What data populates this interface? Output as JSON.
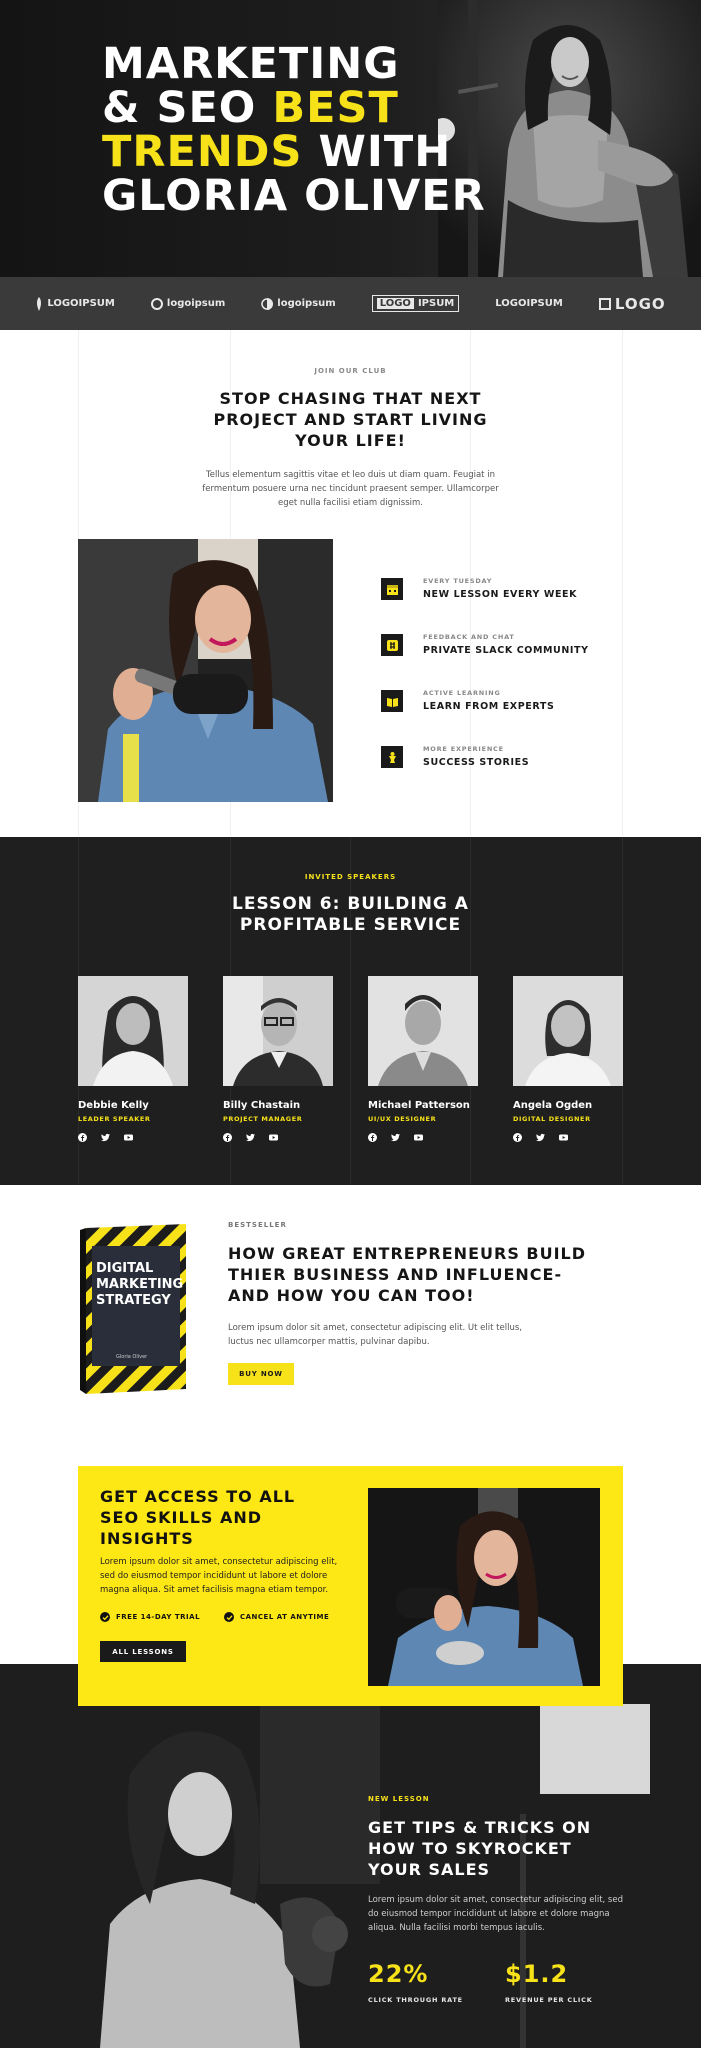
{
  "hero": {
    "title_line1": "MARKETING",
    "title_line2_a": "& SEO ",
    "title_line2_b": "BEST",
    "title_line3_a": "TRENDS",
    "title_line3_b": " WITH",
    "title_line4": "GLORIA OLIVER",
    "accent": "#f7e21a"
  },
  "logos": [
    "LOGOIPSUM",
    "logoipsum",
    "logoipsum",
    "IPSUM",
    "LOGOIPSUM",
    "LOGO"
  ],
  "club": {
    "eyebrow": "JOIN OUR CLUB",
    "title": "STOP CHASING THAT NEXT PROJECT AND START LIVING YOUR LIFE!",
    "text": "Tellus elementum sagittis vitae et leo duis ut diam quam. Feugiat in fermentum posuere urna nec tincidunt praesent semper. Ullamcorper eget nulla facilisi etiam dignissim.",
    "features": [
      {
        "small": "EVERY TUESDAY",
        "big": "NEW LESSON EVERY WEEK",
        "icon": "calendar-icon"
      },
      {
        "small": "FEEDBACK AND CHAT",
        "big": "PRIVATE SLACK COMMUNITY",
        "icon": "slack-icon"
      },
      {
        "small": "ACTIVE LEARNING",
        "big": "LEARN FROM EXPERTS",
        "icon": "book-icon"
      },
      {
        "small": "MORE EXPERIENCE",
        "big": "SUCCESS STORIES",
        "icon": "trophy-icon"
      }
    ]
  },
  "speakers": {
    "eyebrow": "INVITED SPEAKERS",
    "title": "LESSON 6: BUILDING A PROFITABLE SERVICE",
    "items": [
      {
        "name": "Debbie Kelly",
        "role": "LEADER SPEAKER"
      },
      {
        "name": "Billy Chastain",
        "role": "PROJECT MANAGER"
      },
      {
        "name": "Michael Patterson",
        "role": "UI/UX DESIGNER"
      },
      {
        "name": "Angela Ogden",
        "role": "DIGITAL DESIGNER"
      }
    ]
  },
  "bestseller": {
    "eyebrow": "BESTSELLER",
    "title": "HOW GREAT ENTREPRENEURS BUILD THIER BUSINESS AND INFLUENCE- AND HOW YOU CAN TOO!",
    "text": "Lorem ipsum dolor sit amet, consectetur adipiscing elit. Ut elit tellus, luctus nec ullamcorper mattis, pulvinar dapibu.",
    "button": "BUY NOW",
    "book_title": "DIGITAL MARKETING STRATEGY",
    "book_author": "Gloria Oliver"
  },
  "access": {
    "title": "GET ACCESS TO ALL SEO SKILLS AND INSIGHTS",
    "text": "Lorem ipsum dolor sit amet, consectetur adipiscing elit, sed do eiusmod tempor incididunt ut labore et dolore magna aliqua. Sit amet facilisis magna etiam tempor.",
    "check1": "FREE 14-DAY TRIAL",
    "check2": "CANCEL AT ANYTIME",
    "button": "ALL LESSONS"
  },
  "new_lesson": {
    "eyebrow": "NEW LESSON",
    "title": "GET TIPS & TRICKS ON HOW TO SKYROCKET YOUR SALES",
    "text": "Lorem ipsum dolor sit amet, consectetur adipiscing elit, sed do eiusmod tempor incididunt ut labore et dolore magna aliqua. Nulla facilisi morbi tempus iaculis.",
    "stat1_value": "22%",
    "stat1_label": "CLICK THROUGH RATE",
    "stat2_value": "$1.2",
    "stat2_label": "REVENUE PER CLICK"
  }
}
